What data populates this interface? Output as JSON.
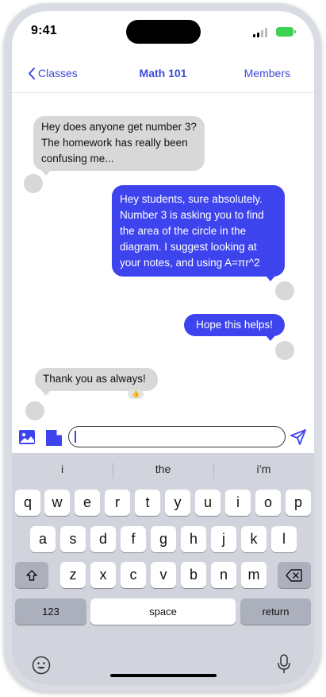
{
  "status": {
    "time": "9:41"
  },
  "nav": {
    "back_label": "Classes",
    "title": "Math 101",
    "members_label": "Members"
  },
  "messages": [
    {
      "sender": "student",
      "text_lines": [
        "Hey does anyone get number 3?",
        "The homework has really been",
        "confusing me..."
      ]
    },
    {
      "sender": "teacher",
      "text_lines": [
        "Hey students, sure absolutely.",
        "Number 3 is asking you to find",
        "the area of the circle in the",
        "diagram. I suggest looking at",
        "your notes, and using A=πr^2"
      ]
    },
    {
      "sender": "teacher",
      "text_lines": [
        "Hope this helps!"
      ]
    },
    {
      "sender": "student",
      "text_lines": [
        "Thank you as always!"
      ],
      "reaction": "👍"
    }
  ],
  "input": {
    "value": "",
    "placeholder": ""
  },
  "keyboard": {
    "suggestions": [
      "i",
      "the",
      "i’m"
    ],
    "row1": [
      "q",
      "w",
      "e",
      "r",
      "t",
      "y",
      "u",
      "i",
      "o",
      "p"
    ],
    "row2": [
      "a",
      "s",
      "d",
      "f",
      "g",
      "h",
      "j",
      "k",
      "l"
    ],
    "row3": [
      "z",
      "x",
      "c",
      "v",
      "b",
      "n",
      "m"
    ],
    "numbers_label": "123",
    "space_label": "space",
    "return_label": "return"
  },
  "colors": {
    "accent": "#3d44ee",
    "incoming_bubble": "#d8d8d8",
    "keyboard_bg": "#d1d4dc"
  },
  "icons": [
    "chevron-left-icon",
    "photo-icon",
    "document-icon",
    "send-icon",
    "shift-icon",
    "backspace-icon",
    "emoji-icon",
    "microphone-icon"
  ]
}
